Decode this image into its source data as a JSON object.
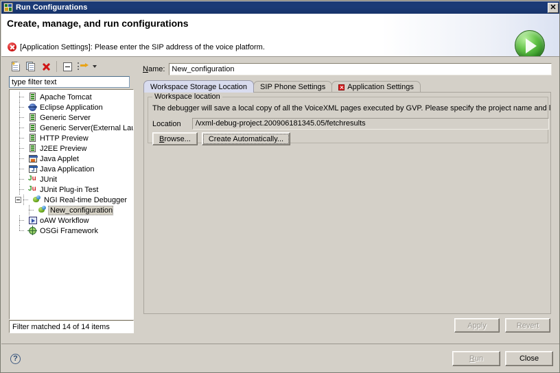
{
  "window": {
    "title": "Run Configurations",
    "close_label": "✕",
    "icon": "run-configurations-icon"
  },
  "header": {
    "title": "Create, manage, and run configurations",
    "message": "[Application Settings]: Please enter the SIP address of the voice platform.",
    "message_icon": "error-icon",
    "badge_icon": "run-play-icon"
  },
  "left_panel": {
    "toolbar": [
      {
        "name": "new-configuration-icon",
        "tooltip": "New launch configuration"
      },
      {
        "name": "duplicate-configuration-icon",
        "tooltip": "Duplicate"
      },
      {
        "name": "delete-configuration-icon",
        "tooltip": "Delete"
      },
      {
        "name": "collapse-all-icon",
        "tooltip": "Collapse All"
      },
      {
        "name": "filter-icon",
        "tooltip": "Filter launch configurations"
      },
      {
        "name": "chevron-down-icon",
        "tooltip": "Menu"
      }
    ],
    "filter": {
      "value": "type filter text",
      "placeholder": "type filter text"
    },
    "status": "Filter matched 14 of 14 items",
    "tree": [
      {
        "label": "Apache Tomcat",
        "icon": "server-icon",
        "level": 1,
        "selected": false
      },
      {
        "label": "Eclipse Application",
        "icon": "eclipse-icon",
        "level": 1,
        "selected": false
      },
      {
        "label": "Generic Server",
        "icon": "server-icon",
        "level": 1,
        "selected": false
      },
      {
        "label": "Generic Server(External Launch)",
        "icon": "server-icon",
        "level": 1,
        "selected": false
      },
      {
        "label": "HTTP Preview",
        "icon": "server-icon",
        "level": 1,
        "selected": false
      },
      {
        "label": "J2EE Preview",
        "icon": "server-icon",
        "level": 1,
        "selected": false
      },
      {
        "label": "Java Applet",
        "icon": "java-applet-icon",
        "level": 1,
        "selected": false
      },
      {
        "label": "Java Application",
        "icon": "java-application-icon",
        "level": 1,
        "selected": false
      },
      {
        "label": "JUnit",
        "icon": "junit-icon",
        "level": 1,
        "selected": false
      },
      {
        "label": "JUnit Plug-in Test",
        "icon": "junit-plugin-icon",
        "level": 1,
        "selected": false
      },
      {
        "label": "NGI Real-time Debugger",
        "icon": "debugger-icon",
        "level": 1,
        "selected": false,
        "expanded": true
      },
      {
        "label": "New_configuration",
        "icon": "debugger-icon",
        "level": 2,
        "selected": true
      },
      {
        "label": "oAW Workflow",
        "icon": "oaw-workflow-icon",
        "level": 1,
        "selected": false
      },
      {
        "label": "OSGi Framework",
        "icon": "osgi-icon",
        "level": 1,
        "selected": false
      }
    ]
  },
  "right_panel": {
    "name_label": "Name:",
    "name_value": "New_configuration",
    "tabs": [
      {
        "label": "Workspace Storage Location",
        "active": true,
        "error": false
      },
      {
        "label": "SIP Phone Settings",
        "active": false,
        "error": false
      },
      {
        "label": "Application Settings",
        "active": false,
        "error": true
      }
    ],
    "group": {
      "legend": "Workspace location",
      "description": "The debugger will save a local copy of all the VoiceXML pages executed by GVP. Please specify the project name and location for saving these",
      "location_label": "Location",
      "location_value": "/vxml-debug-project.200906181345.05/fetchresults",
      "browse_label": "Browse...",
      "create_auto_label": "Create Automatically..."
    },
    "apply_label": "Apply",
    "revert_label": "Revert"
  },
  "footer": {
    "help_icon": "help-icon",
    "help_glyph": "?",
    "run_label": "Run",
    "close_label": "Close"
  },
  "colors": {
    "titlebar": "#1b3a76",
    "dialog": "#d4d0c8",
    "active_tab": "#d9dcef",
    "error": "#d61b1b",
    "run_green": "#2f8f22"
  }
}
